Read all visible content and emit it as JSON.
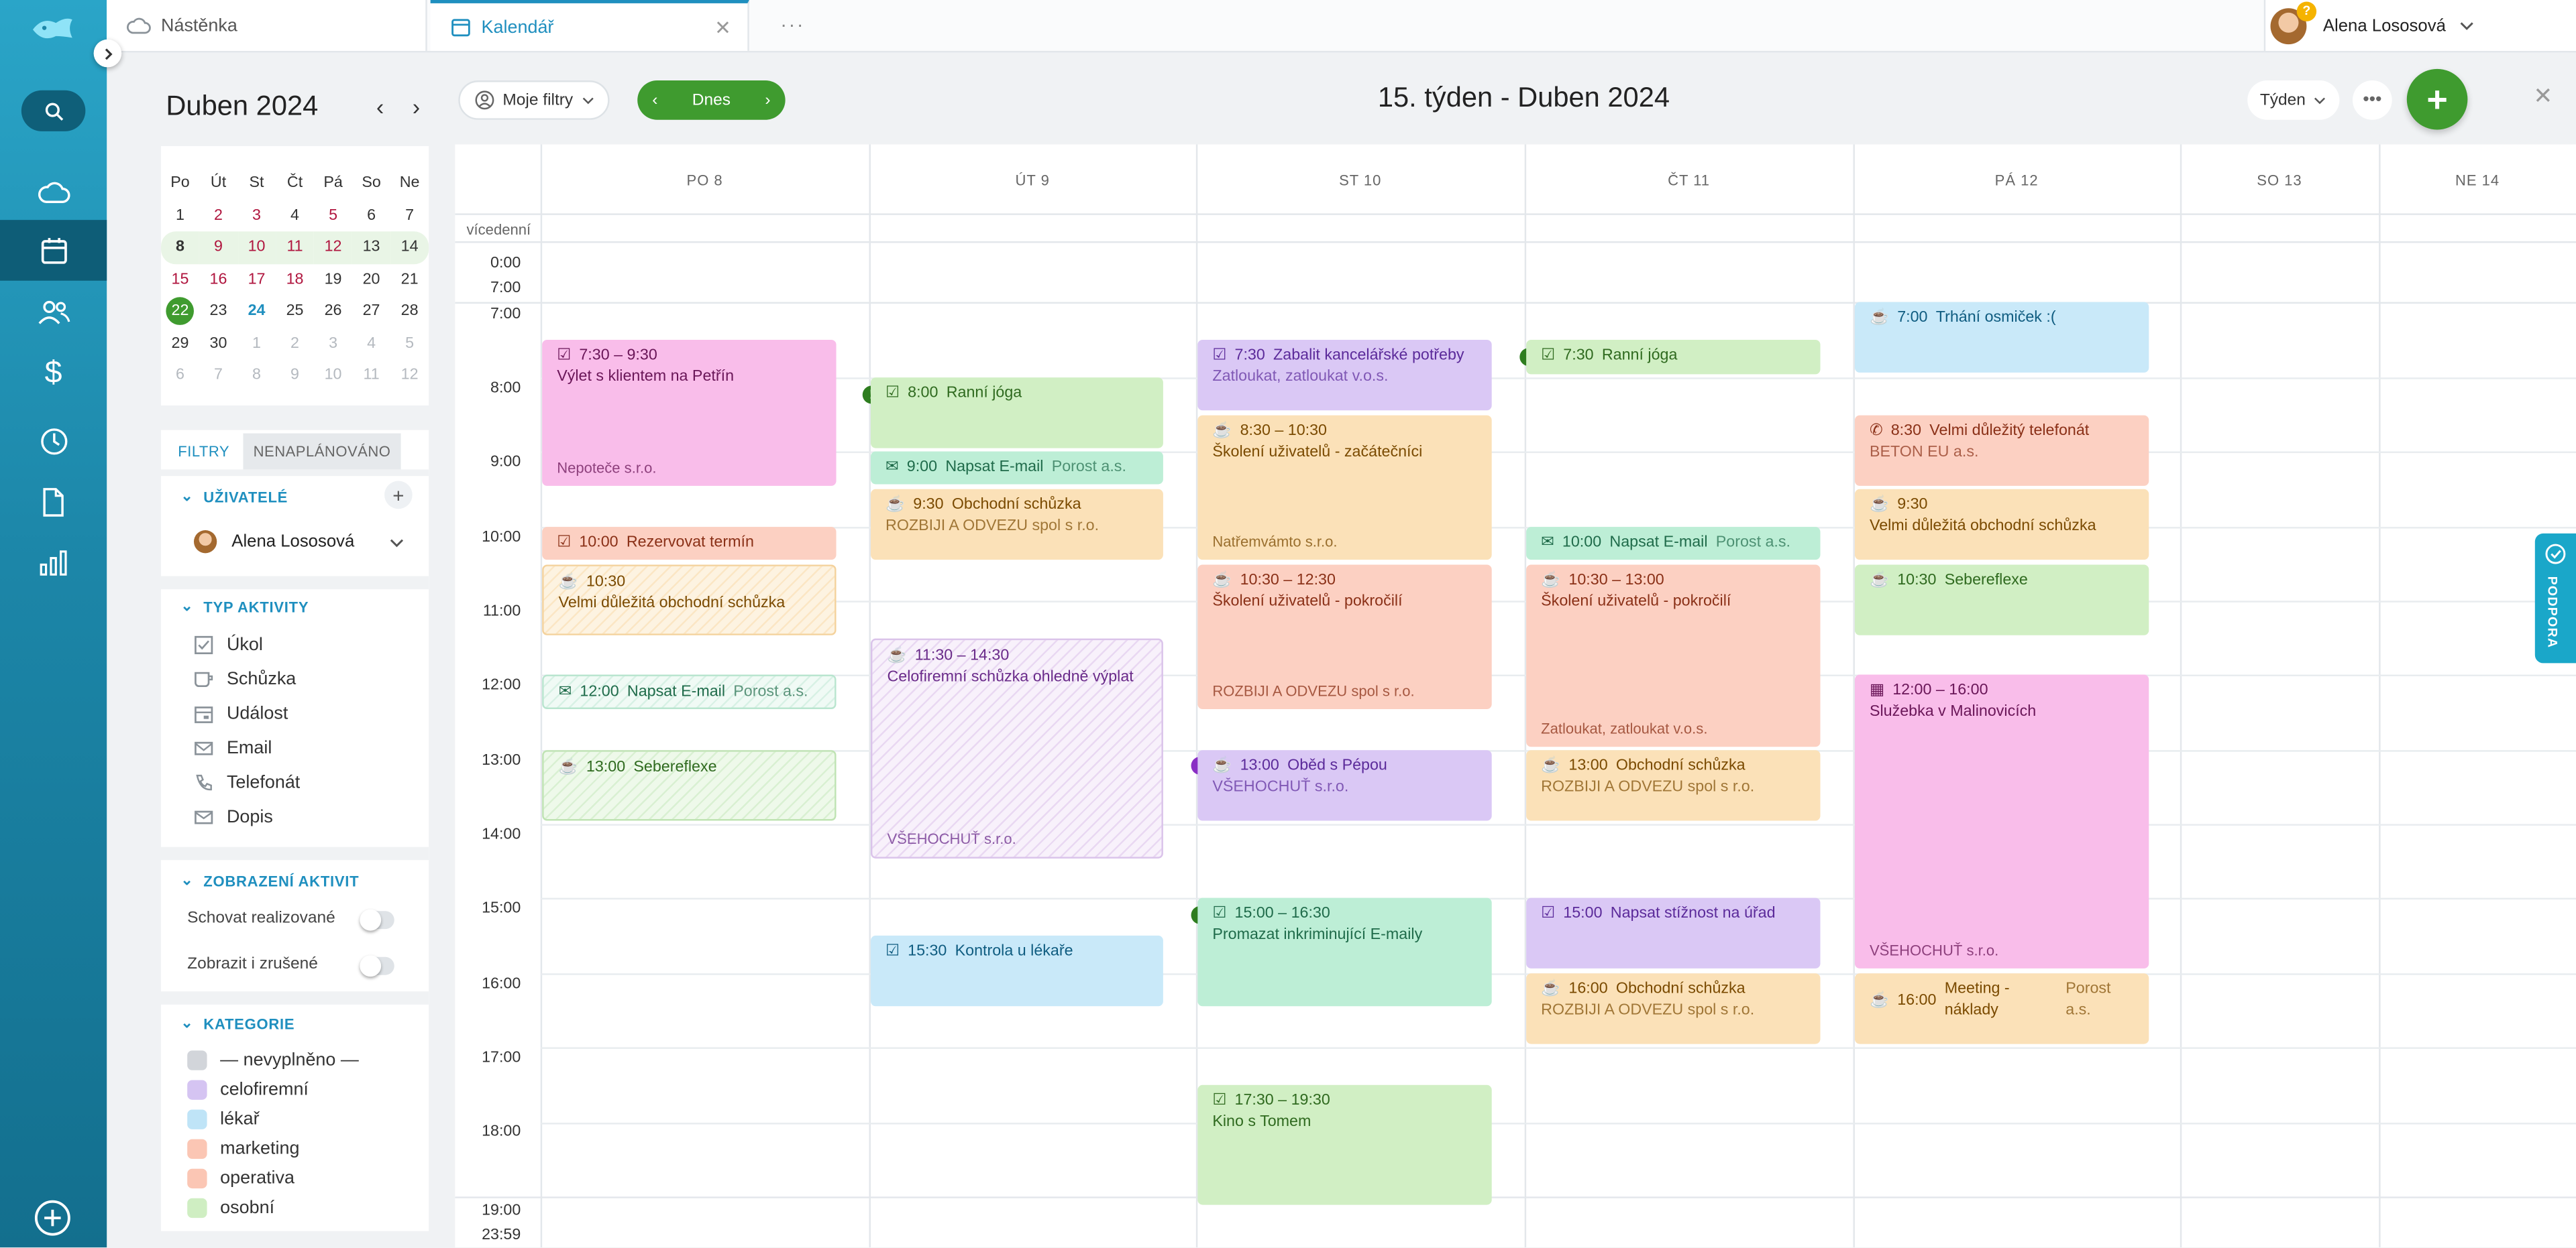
{
  "tabs": {
    "dashboard": "Nástěnka",
    "calendar": "Kalendář",
    "more": "···"
  },
  "user": {
    "name": "Alena Lososová",
    "badge": "?"
  },
  "mini_calendar": {
    "month": "Duben",
    "year": "2024",
    "weekdays": [
      "Po",
      "Út",
      "St",
      "Čt",
      "Pá",
      "So",
      "Ne"
    ]
  },
  "filters": {
    "tab_filters": "FILTRY",
    "tab_unplanned": "NENAPLÁNOVÁNO",
    "users_header": "UŽIVATELÉ",
    "user_name": "Alena Lososová",
    "activity_header": "TYP AKTIVITY",
    "types": [
      "Úkol",
      "Schůzka",
      "Událost",
      "Email",
      "Telefonát",
      "Dopis"
    ],
    "display_header": "ZOBRAZENÍ AKTIVIT",
    "hide_done": "Schovat realizované",
    "show_cancelled": "Zobrazit i zrušené",
    "categories_header": "KATEGORIE",
    "categories": [
      "— nevyplněno —",
      "celofiremní",
      "lékař",
      "marketing",
      "operativa",
      "osobní"
    ]
  },
  "toolbar": {
    "my_filters": "Moje filtry",
    "today": "Dnes",
    "week_title": "15. týden - Duben 2024",
    "view": "Týden"
  },
  "calendar": {
    "days": [
      "PO 8",
      "ÚT 9",
      "ST 10",
      "ČT 11",
      "PÁ 12",
      "SO 13",
      "NE 14"
    ],
    "multiday": "vícedenní",
    "time_labels": [
      "0:00",
      "7:00",
      "7:00",
      "8:00",
      "9:00",
      "10:00",
      "11:00",
      "12:00",
      "13:00",
      "14:00",
      "15:00",
      "16:00",
      "17:00",
      "18:00",
      "19:00",
      "23:59"
    ],
    "events": [
      {
        "time": "7:30 – 9:30",
        "title": "Výlet s klientem na Petřín",
        "org": "Nepoteče s.r.o."
      },
      {
        "time": "10:00",
        "title": "Rezervovat termín"
      },
      {
        "time": "10:30",
        "title": "Velmi důležitá obchodní schůzka"
      },
      {
        "time": "12:00",
        "title": "Napsat E-mail",
        "org": "Porost a.s."
      },
      {
        "time": "13:00",
        "title": "Sebereflexe"
      },
      {
        "time": "8:00",
        "title": "Ranní jóga"
      },
      {
        "time": "9:00",
        "title": "Napsat E-mail",
        "org": "Porost a.s."
      },
      {
        "time": "9:30",
        "title": "Obchodní schůzka",
        "org": "ROZBIJI A ODVEZU spol s r.o."
      },
      {
        "time": "11:30 – 14:30",
        "title": "Celofiremní schůzka ohledně výplat",
        "org": "VŠEHOCHUŤ s.r.o."
      },
      {
        "time": "15:30",
        "title": "Kontrola u lékaře"
      },
      {
        "time": "7:30",
        "title": "Zabalit kancelářské potřeby",
        "org": "Zatloukat, zatloukat v.o.s."
      },
      {
        "time": "8:30 – 10:30",
        "title": "Školení uživatelů - začátečníci",
        "org": "Natřemvámto s.r.o."
      },
      {
        "time": "10:30 – 12:30",
        "title": "Školení uživatelů - pokročilí",
        "org": "ROZBIJI A ODVEZU spol s r.o."
      },
      {
        "time": "13:00",
        "title": "Oběd s Pépou",
        "org": "VŠEHOCHUŤ s.r.o."
      },
      {
        "time": "15:00 – 16:30",
        "title": "Promazat inkriminující E-maily"
      },
      {
        "time": "17:30 – 19:30",
        "title": "Kino s Tomem"
      },
      {
        "time": "7:30",
        "title": "Ranní jóga"
      },
      {
        "time": "10:00",
        "title": "Napsat E-mail",
        "org": "Porost a.s."
      },
      {
        "time": "10:30 – 13:00",
        "title": "Školení uživatelů - pokročilí",
        "org": "Zatloukat, zatloukat v.o.s."
      },
      {
        "time": "13:00",
        "title": "Obchodní schůzka",
        "org": "ROZBIJI A ODVEZU spol s r.o."
      },
      {
        "time": "15:00",
        "title": "Napsat stížnost na úřad"
      },
      {
        "time": "16:00",
        "title": "Obchodní schůzka",
        "org": "ROZBIJI A ODVEZU spol s r.o."
      },
      {
        "time": "7:00",
        "title": "Trhání osmiček :("
      },
      {
        "time": "8:30",
        "title": "Velmi důležitý telefonát",
        "org": "BETON EU a.s."
      },
      {
        "time": "9:30",
        "title": "Velmi důležitá obchodní schůzka"
      },
      {
        "time": "10:30",
        "title": "Sebereflexe"
      },
      {
        "time": "12:00 – 16:00",
        "title": "Služebka v Malinovicích",
        "org": "VŠEHOCHUŤ s.r.o."
      },
      {
        "time": "16:00",
        "title": "Meeting - náklady",
        "org": "Porost a.s."
      }
    ]
  },
  "support": "PODPORA",
  "colors": {
    "accent": "#1f8fbf",
    "green": "#3f9b2f",
    "red": "#b0163f"
  }
}
